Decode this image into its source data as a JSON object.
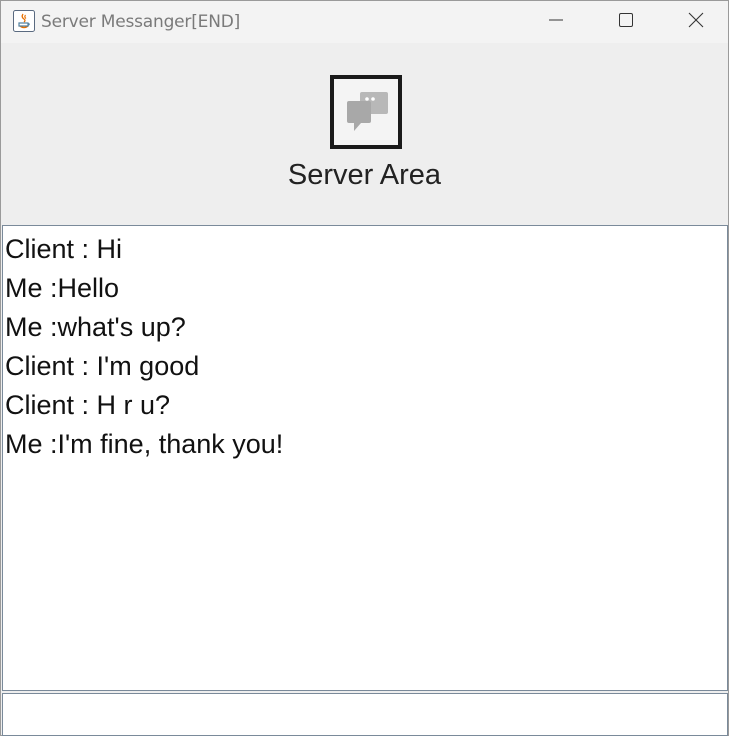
{
  "window": {
    "title": "Server Messanger[END]",
    "icons": {
      "app": "java-app-icon",
      "minimize": "minimize-icon",
      "maximize": "maximize-icon",
      "close": "close-icon"
    }
  },
  "header": {
    "logo_icon": "chat-bubbles-icon",
    "title": "Server Area"
  },
  "messages": [
    "Client : Hi",
    "Me :Hello",
    "Me :what's up?",
    "Client : I'm good",
    "Client : H r u?",
    "Me :I'm fine, thank you!"
  ],
  "input": {
    "value": "",
    "placeholder": ""
  },
  "colors": {
    "background": "#eeeeee",
    "text": "#111111",
    "border": "#7a8a9a"
  }
}
